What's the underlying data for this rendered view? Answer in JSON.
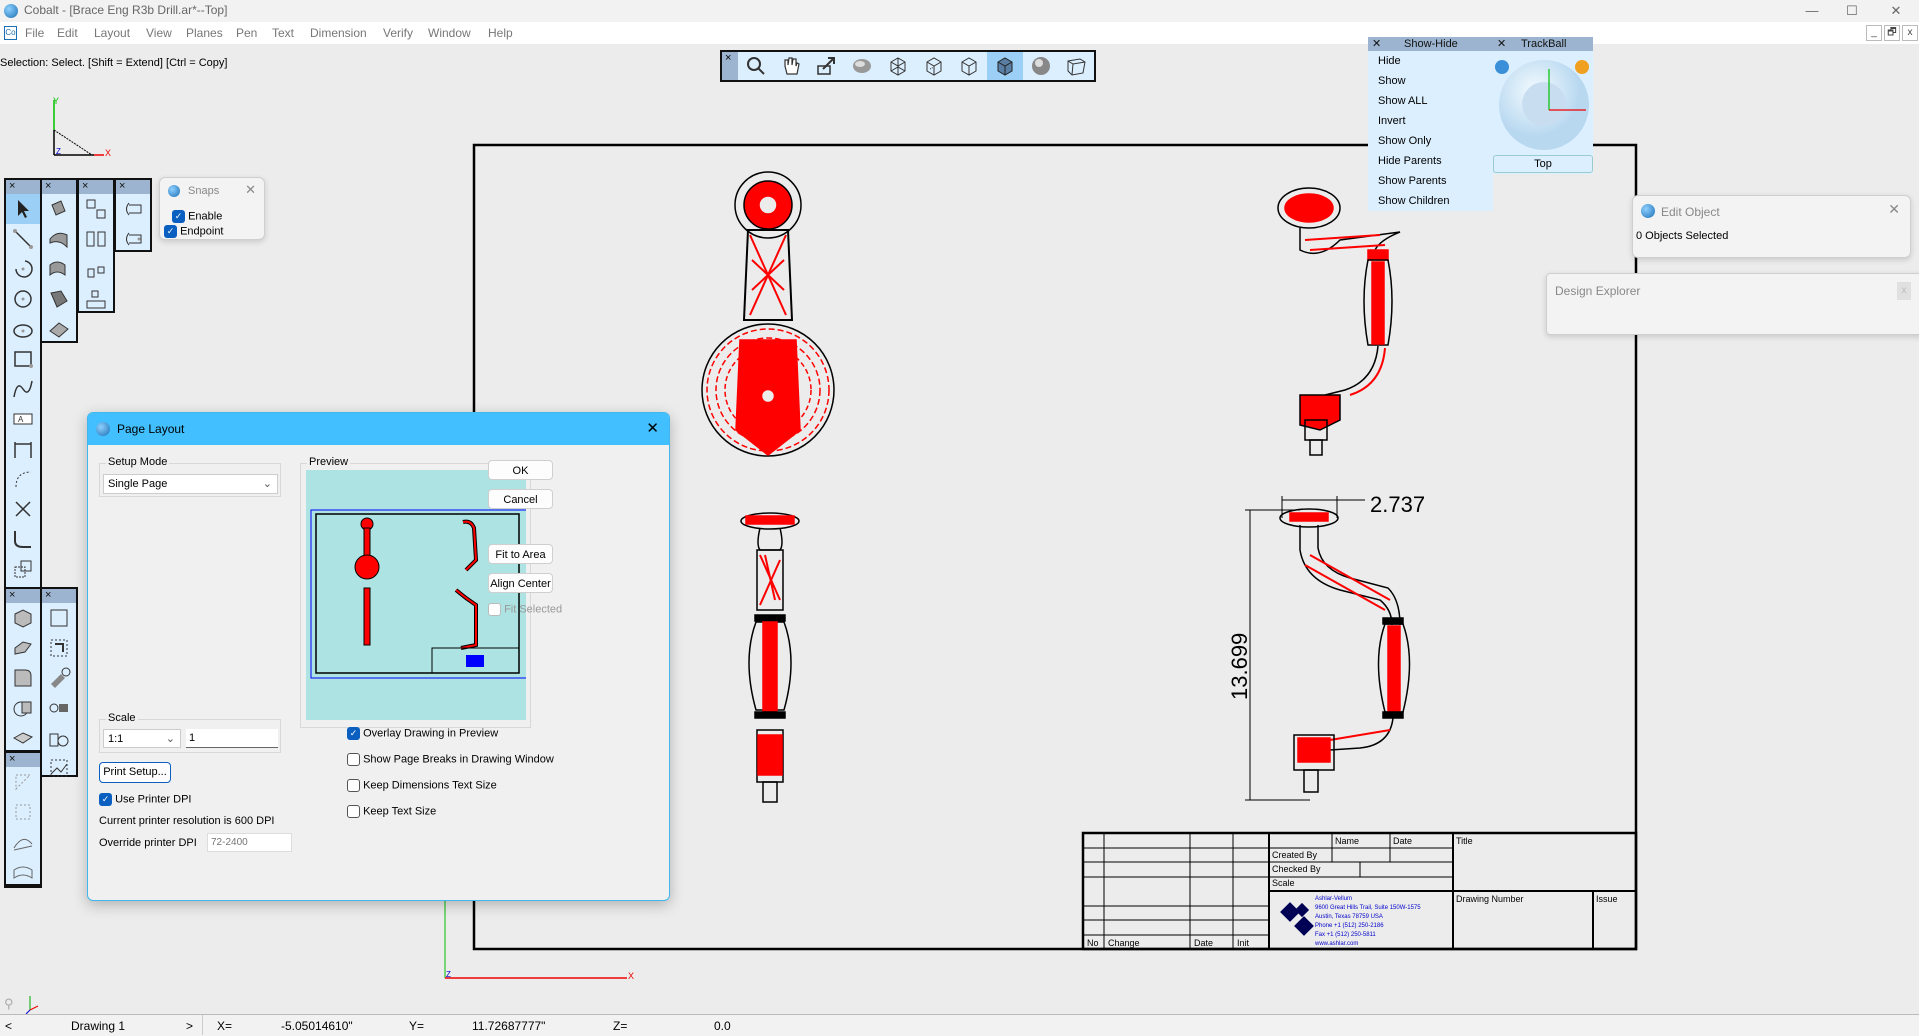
{
  "app": {
    "title": "Cobalt - [Brace Eng R3b Drill.ar*--Top]",
    "window_controls": {
      "minimize": "—",
      "maximize": "☐",
      "close": "✕"
    },
    "mdi_controls": {
      "minimize": "_",
      "restore": "🗗",
      "close": "x"
    }
  },
  "menu": [
    "File",
    "Edit",
    "Layout",
    "View",
    "Planes",
    "Pen",
    "Text",
    "Dimension",
    "Verify",
    "Window",
    "Help"
  ],
  "status_hint": "Selection: Select. [Shift = Extend] [Ctrl = Copy]",
  "view_toolbar": {
    "close": "×",
    "buttons": [
      "zoom",
      "pan",
      "zoom-extents",
      "rotate",
      "wireframe",
      "hidden-line",
      "outline",
      "shaded",
      "rendered",
      "perspective"
    ],
    "active": "shaded"
  },
  "show_hide": {
    "title": "Show-Hide",
    "close": "✕",
    "items": [
      "Hide",
      "Show",
      "Show ALL",
      "Invert",
      "Show Only",
      "Hide Parents",
      "Show Parents",
      "Show Children"
    ]
  },
  "trackball": {
    "title": "TrackBall",
    "close": "✕",
    "view_label": "Top"
  },
  "snaps": {
    "title": "Snaps",
    "close": "✕",
    "enable_label": "Enable",
    "enable_checked": true,
    "endpoint_label": "Endpoint",
    "endpoint_checked": true
  },
  "edit_object": {
    "title": "Edit Object",
    "close": "✕",
    "status": "0 Objects Selected"
  },
  "design_explorer": {
    "title": "Design Explorer",
    "close": "x"
  },
  "toolbars": {
    "close": "×"
  },
  "page_layout": {
    "title": "Page Layout",
    "close": "✕",
    "setup_mode_label": "Setup Mode",
    "setup_mode_value": "Single Page",
    "preview_label": "Preview",
    "ok": "OK",
    "cancel": "Cancel",
    "fit_to_area": "Fit to Area",
    "align_center": "Align Center",
    "fit_selected": "Fit Selected",
    "fit_selected_checked": false,
    "scale_label": "Scale",
    "scale_ratio": "1:1",
    "scale_value": "1",
    "print_setup": "Print Setup...",
    "use_printer_dpi": "Use Printer DPI",
    "use_printer_dpi_checked": true,
    "printer_resolution": "Current printer resolution is 600 DPI",
    "override_dpi_label": "Override printer DPI",
    "override_dpi_placeholder": "72-2400",
    "overlay_drawing": "Overlay Drawing in Preview",
    "overlay_drawing_checked": true,
    "show_page_breaks": "Show Page Breaks in Drawing Window",
    "show_page_breaks_checked": false,
    "keep_dim_text": "Keep Dimensions Text Size",
    "keep_dim_text_checked": false,
    "keep_text": "Keep Text Size",
    "keep_text_checked": false
  },
  "drawing": {
    "dim_width": "2.737",
    "dim_height": "13.699",
    "axis_labels": {
      "x": "X",
      "y": "Y",
      "z": "Z"
    },
    "title_block": {
      "rev_headers": [
        "No",
        "Change",
        "Date",
        "Init"
      ],
      "name": "Name",
      "date": "Date",
      "created_by": "Created By",
      "checked_by": "Checked By",
      "scale": "Scale",
      "title": "Title",
      "drawing_number": "Drawing Number",
      "issue": "Issue",
      "company": [
        "Ashlar-Vellum",
        "9600 Great Hills Trail, Suite 150W-1575",
        "Austin, Texas 78759 USA",
        "Phone +1 (512) 250-2186",
        "Fax +1 (512) 250-5811",
        "www.ashlar.com"
      ]
    }
  },
  "statusbar": {
    "prev": "<",
    "drawing_tab": "Drawing 1",
    "next": ">",
    "x_label": "X=",
    "x_value": "-5.05014610\"",
    "y_label": "Y=",
    "y_value": "11.72687777\"",
    "z_label": "Z=",
    "z_value": "0.0"
  },
  "colors": {
    "accent": "#41bfff",
    "toolbar_bg": "#dcefff",
    "toolbar_header": "#9cb4cf",
    "geometry": "#ff0000",
    "preview_bg": "#ade3e3"
  }
}
